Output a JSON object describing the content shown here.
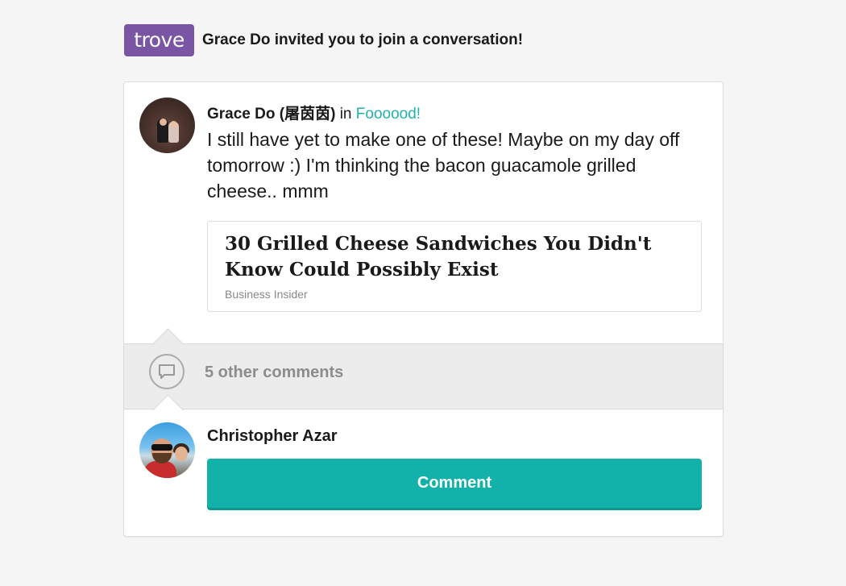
{
  "header": {
    "logo_text": "trove",
    "invite_text": "Grace Do invited you to join a conversation!"
  },
  "post": {
    "author": "Grace Do (屠茵茵)",
    "in_word": "in",
    "group": "Foooood!",
    "text": "I still have yet to make one of these! Maybe on my day off tomorrow :) I'm thinking the bacon guacamole grilled cheese.. mmm"
  },
  "link_card": {
    "title": "30 Grilled Cheese Sandwiches You Didn't Know Could Possibly Exist",
    "source": "Business Insider"
  },
  "comments": {
    "other_count_label": "5 other comments"
  },
  "reply": {
    "user_name": "Christopher Azar",
    "button_label": "Comment"
  },
  "colors": {
    "brand_purple": "#7a55a3",
    "accent_teal": "#12b2ab",
    "link_teal": "#21b2ad"
  }
}
